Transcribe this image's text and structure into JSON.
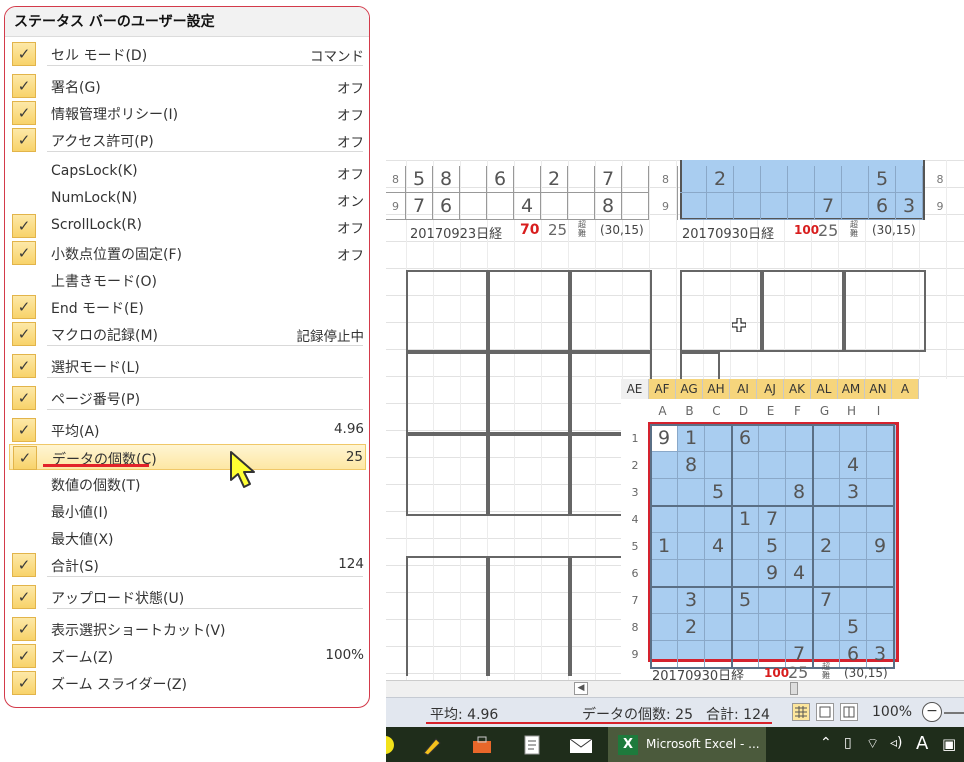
{
  "menu": {
    "title": "ステータス バーのユーザー設定",
    "items": [
      {
        "label": "セル モード(D)",
        "value": "コマンド",
        "checked": true
      },
      {
        "label": "署名(G)",
        "value": "オフ",
        "checked": true
      },
      {
        "label": "情報管理ポリシー(I)",
        "value": "オフ",
        "checked": true
      },
      {
        "label": "アクセス許可(P)",
        "value": "オフ",
        "checked": true
      },
      {
        "label": "CapsLock(K)",
        "value": "オフ",
        "checked": false
      },
      {
        "label": "NumLock(N)",
        "value": "オン",
        "checked": false
      },
      {
        "label": "ScrollLock(R)",
        "value": "オフ",
        "checked": true
      },
      {
        "label": "小数点位置の固定(F)",
        "value": "オフ",
        "checked": true
      },
      {
        "label": "上書きモード(O)",
        "value": "",
        "checked": false
      },
      {
        "label": "End モード(E)",
        "value": "",
        "checked": true
      },
      {
        "label": "マクロの記録(M)",
        "value": "記録停止中",
        "checked": true
      },
      {
        "label": "選択モード(L)",
        "value": "",
        "checked": true
      },
      {
        "label": "ページ番号(P)",
        "value": "",
        "checked": true
      },
      {
        "label": "平均(A)",
        "value": "4.96",
        "checked": true
      },
      {
        "label": "データの個数(C)",
        "value": "25",
        "checked": true
      },
      {
        "label": "数値の個数(T)",
        "value": "",
        "checked": false
      },
      {
        "label": "最小値(I)",
        "value": "",
        "checked": false
      },
      {
        "label": "最大値(X)",
        "value": "",
        "checked": false
      },
      {
        "label": "合計(S)",
        "value": "124",
        "checked": true
      },
      {
        "label": "アップロード状態(U)",
        "value": "",
        "checked": true
      },
      {
        "label": "表示選択ショートカット(V)",
        "value": "",
        "checked": true
      },
      {
        "label": "ズーム(Z)",
        "value": "100%",
        "checked": true
      },
      {
        "label": "ズーム スライダー(Z)",
        "value": "",
        "checked": true
      }
    ]
  },
  "puzzle_top_left": {
    "rows": [
      [
        "8",
        "5",
        "8",
        "",
        "6",
        "",
        "2",
        "",
        "7",
        ""
      ],
      [
        "9",
        "7",
        "6",
        "",
        "",
        "4",
        "",
        "",
        "8",
        ""
      ]
    ],
    "caption": "20170923日経",
    "score": "70",
    "time": "25",
    "tag": "超難",
    "coord": "(30,15)"
  },
  "puzzle_top_right": {
    "row_labels": [
      "8",
      "9"
    ],
    "rows": [
      [
        "",
        "2",
        "",
        "",
        "",
        "",
        "",
        "5",
        ""
      ],
      [
        "",
        "",
        "",
        "",
        "",
        "7",
        "",
        "6",
        "3"
      ]
    ],
    "right_labels": [
      "8",
      "9"
    ],
    "caption": "20170930日経",
    "score": "100",
    "time": "25",
    "tag": "超難",
    "coord": "(30,15)"
  },
  "sheet": {
    "col_headers": [
      "AE",
      "AF",
      "AG",
      "AH",
      "AI",
      "AJ",
      "AK",
      "AL",
      "AM",
      "AN",
      "A"
    ],
    "inner_cols": [
      "A",
      "B",
      "C",
      "D",
      "E",
      "F",
      "G",
      "H",
      "I"
    ],
    "row_labels": [
      "1",
      "2",
      "3",
      "4",
      "5",
      "6",
      "7",
      "8",
      "9"
    ],
    "grid": [
      [
        "9",
        "1",
        "",
        "6",
        "",
        "",
        "",
        "",
        ""
      ],
      [
        "",
        "8",
        "",
        "",
        "",
        "",
        "",
        "4",
        ""
      ],
      [
        "",
        "",
        "5",
        "",
        "",
        "8",
        "",
        "3",
        ""
      ],
      [
        "",
        "",
        "",
        "1",
        "7",
        "",
        "",
        "",
        ""
      ],
      [
        "1",
        "",
        "4",
        "",
        "5",
        "",
        "2",
        "",
        "9"
      ],
      [
        "",
        "",
        "",
        "",
        "9",
        "4",
        "",
        "",
        ""
      ],
      [
        "",
        "3",
        "",
        "5",
        "",
        "",
        "7",
        "",
        ""
      ],
      [
        "",
        "2",
        "",
        "",
        "",
        "",
        "",
        "5",
        ""
      ],
      [
        "",
        "",
        "",
        "",
        "",
        "7",
        "",
        "6",
        "3"
      ]
    ],
    "caption": "20170930日経",
    "score": "100",
    "time": "25",
    "tag": "超難",
    "coord": "(30,15)"
  },
  "statusbar": {
    "average": "平均: 4.96",
    "count": "データの個数: 25",
    "sum": "合計: 124",
    "zoom": "100%"
  },
  "taskbar": {
    "app_label": "Microsoft Excel - ...",
    "ime": "A"
  }
}
